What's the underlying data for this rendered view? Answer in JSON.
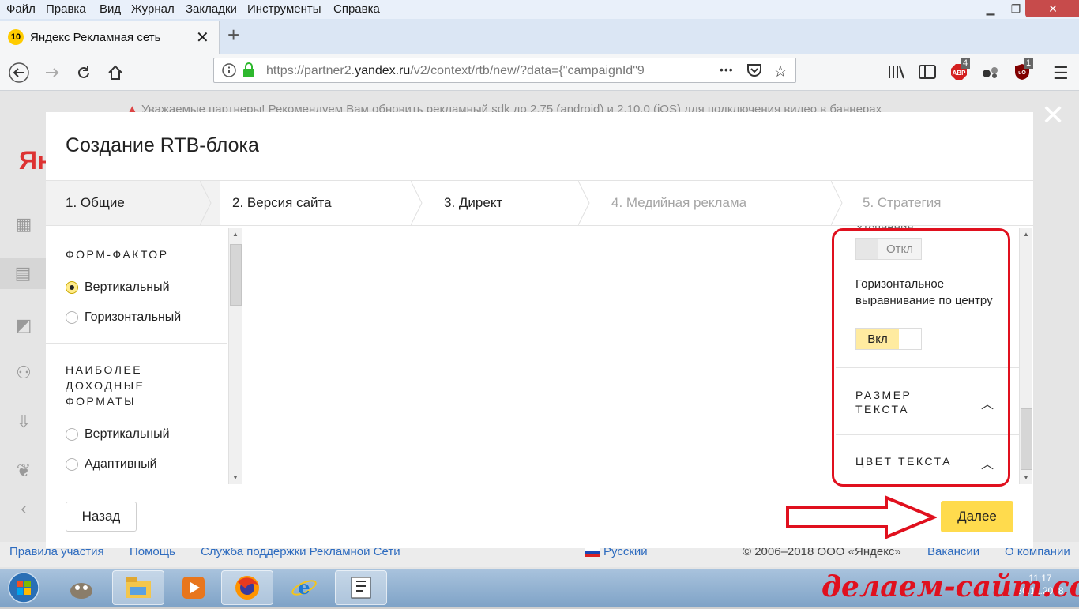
{
  "menubar": {
    "items": [
      "Файл",
      "Правка",
      "Вид",
      "Журнал",
      "Закладки",
      "Инструменты",
      "Справка"
    ],
    "window_buttons": [
      "minimize-icon",
      "restore-icon",
      "close-icon"
    ]
  },
  "tab": {
    "favicon_text": "10",
    "title": "Яндекс Рекламная сеть",
    "close": "✕",
    "new_tab": "+"
  },
  "navbar": {
    "url_prefix": "https://partner2.",
    "url_domain": "yandex.ru",
    "url_rest": "/v2/context/rtb/new/?data={\"campaignId\"9",
    "more": "•••",
    "badge_abp": "4",
    "badge_ublock": "1"
  },
  "page": {
    "notice": "Уважаемые партнеры! Рекомендуем Вам обновить рекламный sdk до 2.75 (android) и 2.10.0 (iOS) для подключения видео в баннерах",
    "logo_fragment": "Ян"
  },
  "modal": {
    "title": "Создание RTB-блока",
    "steps": [
      {
        "label": "1. Общие",
        "state": "active"
      },
      {
        "label": "2. Версия сайта",
        "state": "done"
      },
      {
        "label": "3. Директ",
        "state": "done"
      },
      {
        "label": "4. Медийная реклама",
        "state": "todo"
      },
      {
        "label": "5. Стратегия",
        "state": "todo"
      }
    ],
    "left": {
      "form_factor_title": "ФОРМ-ФАКТОР",
      "form_factor_options": [
        "Вертикальный",
        "Горизонтальный"
      ],
      "form_factor_selected": "Вертикальный",
      "profitable_title_lines": [
        "НАИБОЛЕЕ",
        "ДОХОДНЫЕ",
        "ФОРМАТЫ"
      ],
      "profitable_options": [
        "Вертикальный",
        "Адаптивный"
      ]
    },
    "right": {
      "cut_label": "Уточнения",
      "toggle1": {
        "off": "Откл",
        "state": "off"
      },
      "horizontal_align_label": "Горизонтальное выравнивание по центру",
      "toggle2": {
        "on": "Вкл",
        "state": "on"
      },
      "text_size_lines": [
        "РАЗМЕР",
        "ТЕКСТА"
      ],
      "text_color": "ЦВЕТ ТЕКСТА"
    },
    "back_button": "Назад",
    "next_button": "Далее",
    "overlay_close": "✕"
  },
  "footer": {
    "links": [
      "Правила участия",
      "Помощь",
      "Служба поддержки Рекламной Сети"
    ],
    "language": "Русский",
    "copyright": "© 2006–2018 ООО «Яндекс»",
    "links_right": [
      "Вакансии",
      "О компании"
    ]
  },
  "taskbar": {
    "time": "11:17",
    "date": "30.11.2018"
  },
  "watermark": "делаем-сайт.com",
  "colors": {
    "accent_yellow": "#ffdb4d",
    "highlight_red": "#e0101e",
    "link_blue": "#2d6bbf"
  }
}
